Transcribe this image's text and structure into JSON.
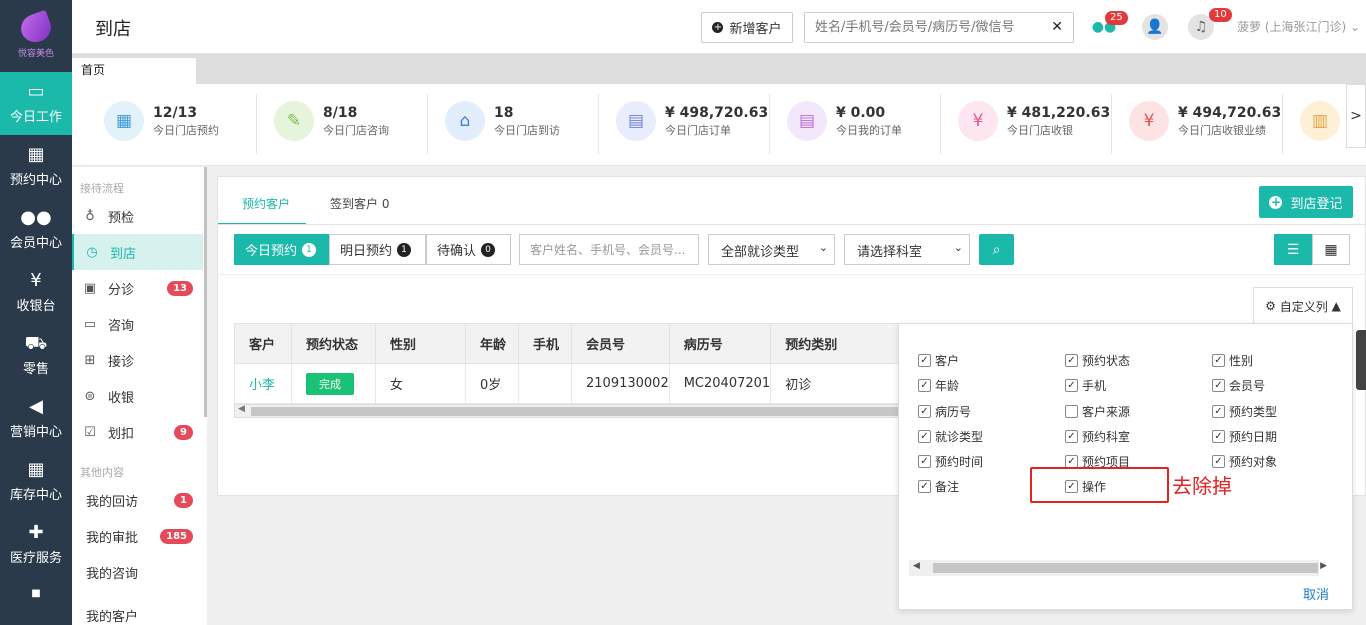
{
  "app": {
    "logo_text": "悦容美色",
    "page_title": "到店"
  },
  "nav": [
    {
      "label": "今日工作",
      "icon": "monitor-icon",
      "glyph": "🖵",
      "active": true
    },
    {
      "label": "预约中心",
      "icon": "calendar-icon",
      "glyph": "▦",
      "active": false
    },
    {
      "label": "会员中心",
      "icon": "users-icon",
      "glyph": "👥",
      "active": false
    },
    {
      "label": "收银台",
      "icon": "yen-icon",
      "glyph": "¥",
      "active": false
    },
    {
      "label": "零售",
      "icon": "cart-icon",
      "glyph": "🛒",
      "active": false
    },
    {
      "label": "营销中心",
      "icon": "megaphone-icon",
      "glyph": "📢",
      "active": false
    },
    {
      "label": "库存中心",
      "icon": "grid-icon",
      "glyph": "▦",
      "active": false
    },
    {
      "label": "医疗服务",
      "icon": "medkit-icon",
      "glyph": "✚",
      "active": false
    }
  ],
  "topbar": {
    "new_customer": "新增客户",
    "search_placeholder": "姓名/手机号/会员号/病历号/微信号",
    "wechat_badge": "25",
    "bell_badge": "10",
    "user": "菠萝 (上海张江门诊)"
  },
  "tabs": {
    "home": "首页"
  },
  "stats": [
    {
      "value": "12/13",
      "label": "今日门店预约",
      "icon": "calendar-check-icon",
      "bg": "#e3f1fb",
      "fg": "#3a9ad9"
    },
    {
      "value": "8/18",
      "label": "今日门店咨询",
      "icon": "chat-icon",
      "bg": "#e7f4dc",
      "fg": "#7cbb4f"
    },
    {
      "value": "18",
      "label": "今日门店到访",
      "icon": "store-icon",
      "bg": "#e2eefb",
      "fg": "#3d7fd3"
    },
    {
      "value": "¥ 498,720.63",
      "label": "今日门店订单",
      "icon": "document-icon",
      "bg": "#e8ecfb",
      "fg": "#6f82d6"
    },
    {
      "value": "¥ 0.00",
      "label": "今日我的订单",
      "icon": "my-order-icon",
      "bg": "#f3e8fb",
      "fg": "#b96bd6"
    },
    {
      "value": "¥ 481,220.63",
      "label": "今日门店收银",
      "icon": "moneybag-icon",
      "bg": "#fde6ef",
      "fg": "#e05b8f"
    },
    {
      "value": "¥ 494,720.63",
      "label": "今日门店收银业绩",
      "icon": "invoice-icon",
      "bg": "#fde3e3",
      "fg": "#e25454"
    },
    {
      "value": "",
      "label": "",
      "icon": "clipboard-icon",
      "bg": "#fdf0d6",
      "fg": "#e9a23b"
    }
  ],
  "submenu": {
    "group1": "接待流程",
    "items": [
      {
        "label": "预检",
        "icon": "stethoscope-icon",
        "glyph": "♁",
        "badge": ""
      },
      {
        "label": "到店",
        "icon": "clock-arrow-icon",
        "glyph": "◷",
        "badge": "",
        "active": true
      },
      {
        "label": "分诊",
        "icon": "triage-icon",
        "glyph": "▣",
        "badge": "13"
      },
      {
        "label": "咨询",
        "icon": "speech-icon",
        "glyph": "▭",
        "badge": ""
      },
      {
        "label": "接诊",
        "icon": "medbox-icon",
        "glyph": "⊞",
        "badge": ""
      },
      {
        "label": "收银",
        "icon": "yen-circle-icon",
        "glyph": "⊜",
        "badge": ""
      },
      {
        "label": "划扣",
        "icon": "checkbox-icon",
        "glyph": "☑",
        "badge": "9"
      }
    ],
    "group2": "其他内容",
    "items2": [
      {
        "label": "我的回访",
        "badge": "1"
      },
      {
        "label": "我的审批",
        "badge": "185"
      },
      {
        "label": "我的咨询",
        "badge": ""
      },
      {
        "label": "我的客户",
        "badge": ""
      }
    ]
  },
  "panel": {
    "tab_reserved": "预约客户",
    "tab_checked": "签到客户 0",
    "register_btn": "到店登记",
    "filters": [
      {
        "label": "今日预约",
        "count": "1",
        "active": true
      },
      {
        "label": "明日预约",
        "count": "1",
        "active": false
      },
      {
        "label": "待确认",
        "count": "0",
        "active": false
      }
    ],
    "keyword_placeholder": "客户姓名、手机号、会员号...",
    "visit_type": "全部就诊类型",
    "department": "请选择科室",
    "custom_columns": "自定义列"
  },
  "table": {
    "headers": [
      "客户",
      "预约状态",
      "性别",
      "年龄",
      "手机",
      "会员号",
      "病历号",
      "预约类别"
    ],
    "rows": [
      [
        "小李",
        "完成",
        "女",
        "0岁",
        "",
        "2109130002",
        "MC20407201",
        "初诊"
      ]
    ]
  },
  "columns_popup": {
    "options": [
      {
        "label": "客户",
        "checked": true
      },
      {
        "label": "预约状态",
        "checked": true
      },
      {
        "label": "性别",
        "checked": true
      },
      {
        "label": "年龄",
        "checked": true
      },
      {
        "label": "手机",
        "checked": true
      },
      {
        "label": "会员号",
        "checked": true
      },
      {
        "label": "病历号",
        "checked": true
      },
      {
        "label": "客户来源",
        "checked": false
      },
      {
        "label": "预约类型",
        "checked": true
      },
      {
        "label": "就诊类型",
        "checked": true
      },
      {
        "label": "预约科室",
        "checked": true
      },
      {
        "label": "预约日期",
        "checked": true
      },
      {
        "label": "预约时间",
        "checked": true
      },
      {
        "label": "预约项目",
        "checked": true
      },
      {
        "label": "预约对象",
        "checked": true
      },
      {
        "label": "备注",
        "checked": true
      },
      {
        "label": "操作",
        "checked": true
      }
    ],
    "cancel": "取消"
  },
  "annotation": {
    "text": "去除掉",
    "color": "#e32222"
  },
  "colors": {
    "accent": "#1bb9a9",
    "nav_bg": "#2b3a4a",
    "badge_red": "#e4393c"
  }
}
